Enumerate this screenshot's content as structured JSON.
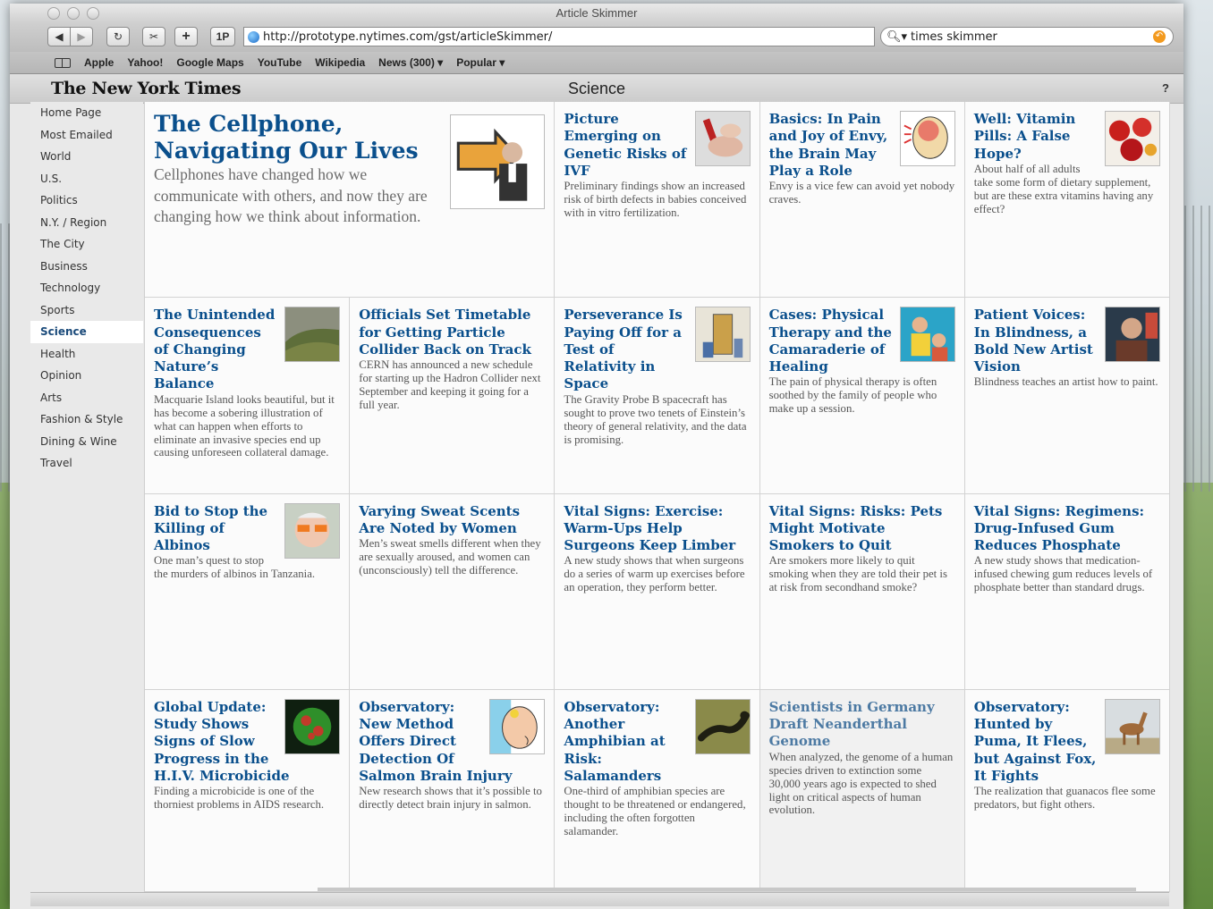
{
  "browser": {
    "window_title": "Article Skimmer",
    "url": "http://prototype.nytimes.com/gst/articleSkimmer/",
    "search_value": "times skimmer",
    "toolbar": {
      "back": "◀",
      "forward": "▶",
      "reload": "C",
      "add": "+",
      "onep": "1P"
    },
    "bookmarks": [
      "Apple",
      "Yahoo!",
      "Google Maps",
      "YouTube",
      "Wikipedia",
      "News (300) ▾",
      "Popular ▾"
    ]
  },
  "page": {
    "logo": "The New York Times",
    "section": "Science",
    "help": "?"
  },
  "sidebar": {
    "items": [
      "Home Page",
      "Most Emailed",
      "World",
      "U.S.",
      "Politics",
      "N.Y. / Region",
      "The City",
      "Business",
      "Technology",
      "Sports",
      "Science",
      "Health",
      "Opinion",
      "Arts",
      "Fashion & Style",
      "Dining & Wine",
      "Travel"
    ],
    "active": "Science"
  },
  "articles": [
    {
      "headline": "The Cellphone, Navigating Our Lives",
      "summary": "Cellphones have changed how we communicate with others, and now they are changing how we think about information.",
      "image": "cellphone-man-arrow"
    },
    {
      "headline": "Picture Emerging on Genetic Risks of IVF",
      "summary": "Preliminary findings show an increased risk of birth defects in babies conceived with in vitro fertilization.",
      "image": "hands-test-tube"
    },
    {
      "headline": "Basics: In Pain and Joy of Envy, the Brain May Play a Role",
      "summary": "Envy is a vice few can avoid yet nobody craves.",
      "image": "brain-illustration"
    },
    {
      "headline": "Well: Vitamin Pills: A False Hope?",
      "summary": "About half of all adults take some form of dietary supplement, but are these extra vitamins having any effect?",
      "image": "strawberries-pills"
    },
    {
      "headline": "The Unintended Consequences of Changing Nature’s Balance",
      "summary": "Macquarie Island looks beautiful, but it has become a sobering illustration of what can happen when efforts to eliminate an invasive species end up causing unforeseen collateral damage.",
      "image": "island-hillside"
    },
    {
      "headline": "Officials Set Timetable for Getting Particle Collider Back on Track",
      "summary": "CERN has announced a new schedule for starting up the Hadron Collider next September and keeping it going for a full year.",
      "image": ""
    },
    {
      "headline": "Perseverance Is Paying Off for a Test of Relativity in Space",
      "summary": "The Gravity Probe B spacecraft has sought to prove two tenets of Einstein’s theory of general relativity, and the data is promising.",
      "image": "spacecraft-lab"
    },
    {
      "headline": "Cases: Physical Therapy and the Camaraderie of Healing",
      "summary": "The pain of physical therapy is often soothed by the family of people who make up a session.",
      "image": "therapy-illustration"
    },
    {
      "headline": "Patient Voices: In Blindness, a Bold New Artist Vision",
      "summary": "Blindness teaches an artist how to paint.",
      "image": "artist-portrait"
    },
    {
      "headline": "Bid to Stop the Killing of Albinos",
      "summary": "One man’s quest to stop the murders of albinos in Tanzania.",
      "image": "man-sunglasses"
    },
    {
      "headline": "Varying Sweat Scents Are Noted by Women",
      "summary": "Men’s sweat smells different when they are sexually aroused, and women can (unconsciously) tell the difference.",
      "image": ""
    },
    {
      "headline": "Vital Signs: Exercise: Warm-Ups Help Surgeons Keep Limber",
      "summary": "A new study shows that when surgeons do a series of warm up exercises before an operation, they perform better.",
      "image": ""
    },
    {
      "headline": "Vital Signs: Risks: Pets Might Motivate Smokers to Quit",
      "summary": "Are smokers more likely to quit smoking when they are told their pet is at risk from secondhand smoke?",
      "image": ""
    },
    {
      "headline": "Vital Signs: Regimens: Drug-Infused Gum Reduces Phosphate",
      "summary": "A new study shows that medication-infused chewing gum reduces levels of phosphate better than standard drugs.",
      "image": ""
    },
    {
      "headline": "Global Update: Study Shows Signs of Slow Progress in the H.I.V. Microbicide",
      "summary": "Finding a microbicide is one of the thorniest problems in AIDS research.",
      "image": "virus-green"
    },
    {
      "headline": "Observatory: New Method Offers Direct Detection Of Salmon Brain Injury",
      "summary": "New research shows that it’s possible to directly detect brain injury in salmon.",
      "image": "cartoon-head"
    },
    {
      "headline": "Observatory: Another Amphibian at Risk: Salamanders",
      "summary": "One-third of amphibian species are thought to be threatened or endangered, including the often forgotten salamander.",
      "image": "salamander"
    },
    {
      "headline": "Scientists in Germany Draft Neanderthal Genome",
      "summary": "When analyzed, the genome of a human species driven to extinction some 30,000 years ago is expected to shed light on critical aspects of human evolution.",
      "image": "",
      "visited": true
    },
    {
      "headline": "Observatory: Hunted by Puma, It Flees, but Against Fox, It Fights",
      "summary": "The realization that guanacos flee some predators, but fight others.",
      "image": "guanaco"
    }
  ]
}
